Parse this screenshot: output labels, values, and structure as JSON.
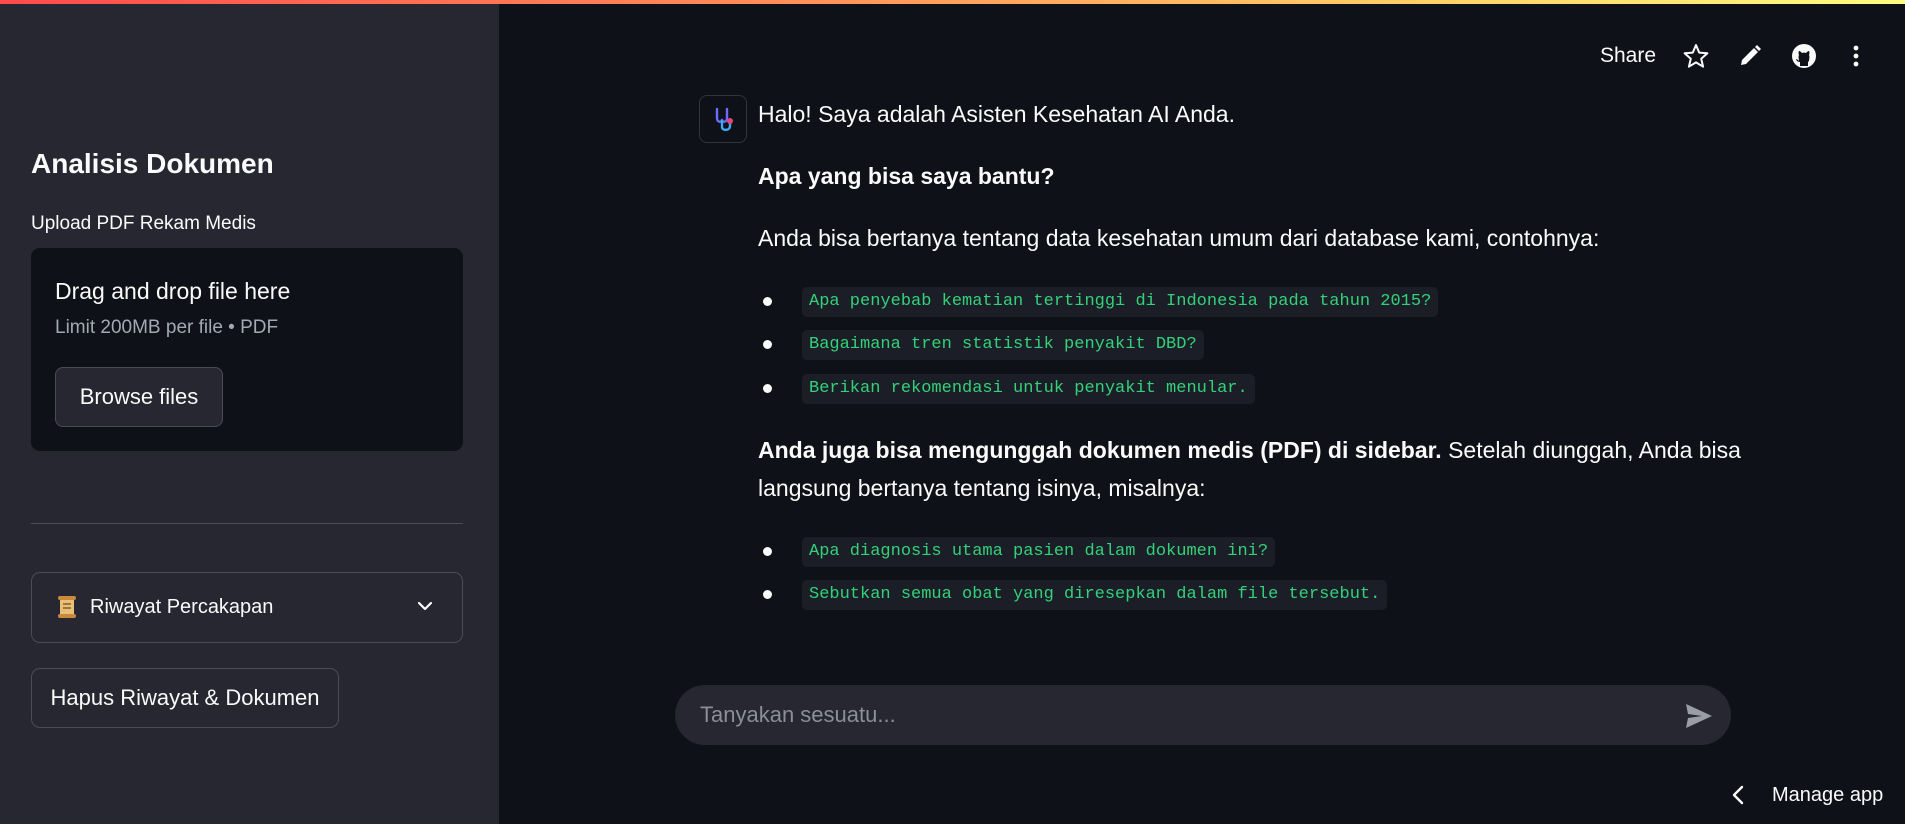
{
  "sidebar": {
    "title": "Analisis Dokumen",
    "upload_label": "Upload PDF Rekam Medis",
    "dropzone": {
      "title": "Drag and drop file here",
      "subtitle": "Limit 200MB per file • PDF",
      "browse_label": "Browse files"
    },
    "expander": {
      "label": "Riwayat Percakapan",
      "icon": "scroll-icon"
    },
    "clear_label": "Hapus Riwayat & Dokumen"
  },
  "toolbar": {
    "share_label": "Share",
    "icons": [
      "star-icon",
      "pencil-icon",
      "github-icon",
      "more-vert-icon"
    ]
  },
  "chat": {
    "avatar_icon": "stethoscope-icon",
    "greeting": "Halo! Saya adalah Asisten Kesehatan AI Anda.",
    "heading": "Apa yang bisa saya bantu?",
    "intro": "Anda bisa bertanya tentang data kesehatan umum dari database kami, contohnya:",
    "examples_db": [
      "Apa penyebab kematian tertinggi di Indonesia pada tahun 2015?",
      "Bagaimana tren statistik penyakit DBD?",
      "Berikan rekomendasi untuk penyakit menular."
    ],
    "pdf_bold": "Anda juga bisa mengunggah dokumen medis (PDF) di sidebar.",
    "pdf_rest_line1": " Setelah diunggah, Anda bisa",
    "pdf_line2": "langsung bertanya tentang isinya, misalnya:",
    "examples_pdf": [
      "Apa diagnosis utama pasien dalam dokumen ini?",
      "Sebutkan semua obat yang diresepkan dalam file tersebut."
    ]
  },
  "input": {
    "placeholder": "Tanyakan sesuatu..."
  },
  "footer": {
    "manage_label": "Manage app"
  }
}
